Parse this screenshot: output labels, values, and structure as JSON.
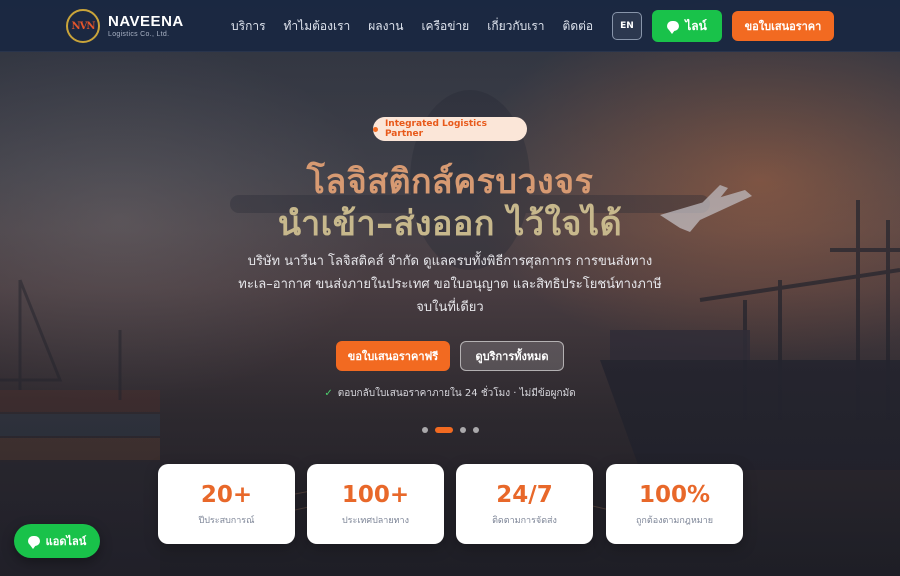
{
  "brand": {
    "mark": "NVN",
    "name": "NAVEENA",
    "sub": "Logistics Co., Ltd."
  },
  "nav": {
    "items": [
      {
        "label": "บริการ"
      },
      {
        "label": "ทำไมต้องเรา"
      },
      {
        "label": "ผลงาน"
      },
      {
        "label": "เครือข่าย"
      },
      {
        "label": "เกี่ยวกับเรา"
      },
      {
        "label": "ติดต่อ"
      }
    ],
    "lang_label": "EN",
    "line_label": "ไลน์",
    "quote_label": "ขอใบเสนอราคา"
  },
  "hero": {
    "badge": "Integrated Logistics Partner",
    "title_line1": "โลจิสติกส์ครบวงจร",
    "title_line2": "นำเข้า–ส่งออก ไว้ใจได้",
    "description": "บริษัท นาวีนา โลจิสติคส์ จำกัด ดูแลครบทั้งพิธีการศุลกากร การขนส่งทางทะเล–อากาศ ขนส่งภายในประเทศ ขอใบอนุญาต และสิทธิประโยชน์ทางภาษี จบในที่เดียว",
    "cta_primary": "ขอใบเสนอราคาฟรี",
    "cta_secondary": "ดูบริการทั้งหมด",
    "note": "ตอบกลับใบเสนอราคาภายใน 24 ชั่วโมง · ไม่มีข้อผูกมัด",
    "slides": 4,
    "active_slide": 2
  },
  "stats": [
    {
      "value": "20+",
      "label": "ปีประสบการณ์"
    },
    {
      "value": "100+",
      "label": "ประเทศปลายทาง"
    },
    {
      "value": "24/7",
      "label": "ติดตามการจัดส่ง"
    },
    {
      "value": "100%",
      "label": "ถูกต้องตามกฎหมาย"
    }
  ],
  "chat_fab": {
    "label": "แอดไลน์"
  },
  "colors": {
    "accent": "#f26a21",
    "line_green": "#19c24a",
    "nav_bg": "#1a2842",
    "title1": "#d79a72",
    "title2": "#c7b88c"
  }
}
